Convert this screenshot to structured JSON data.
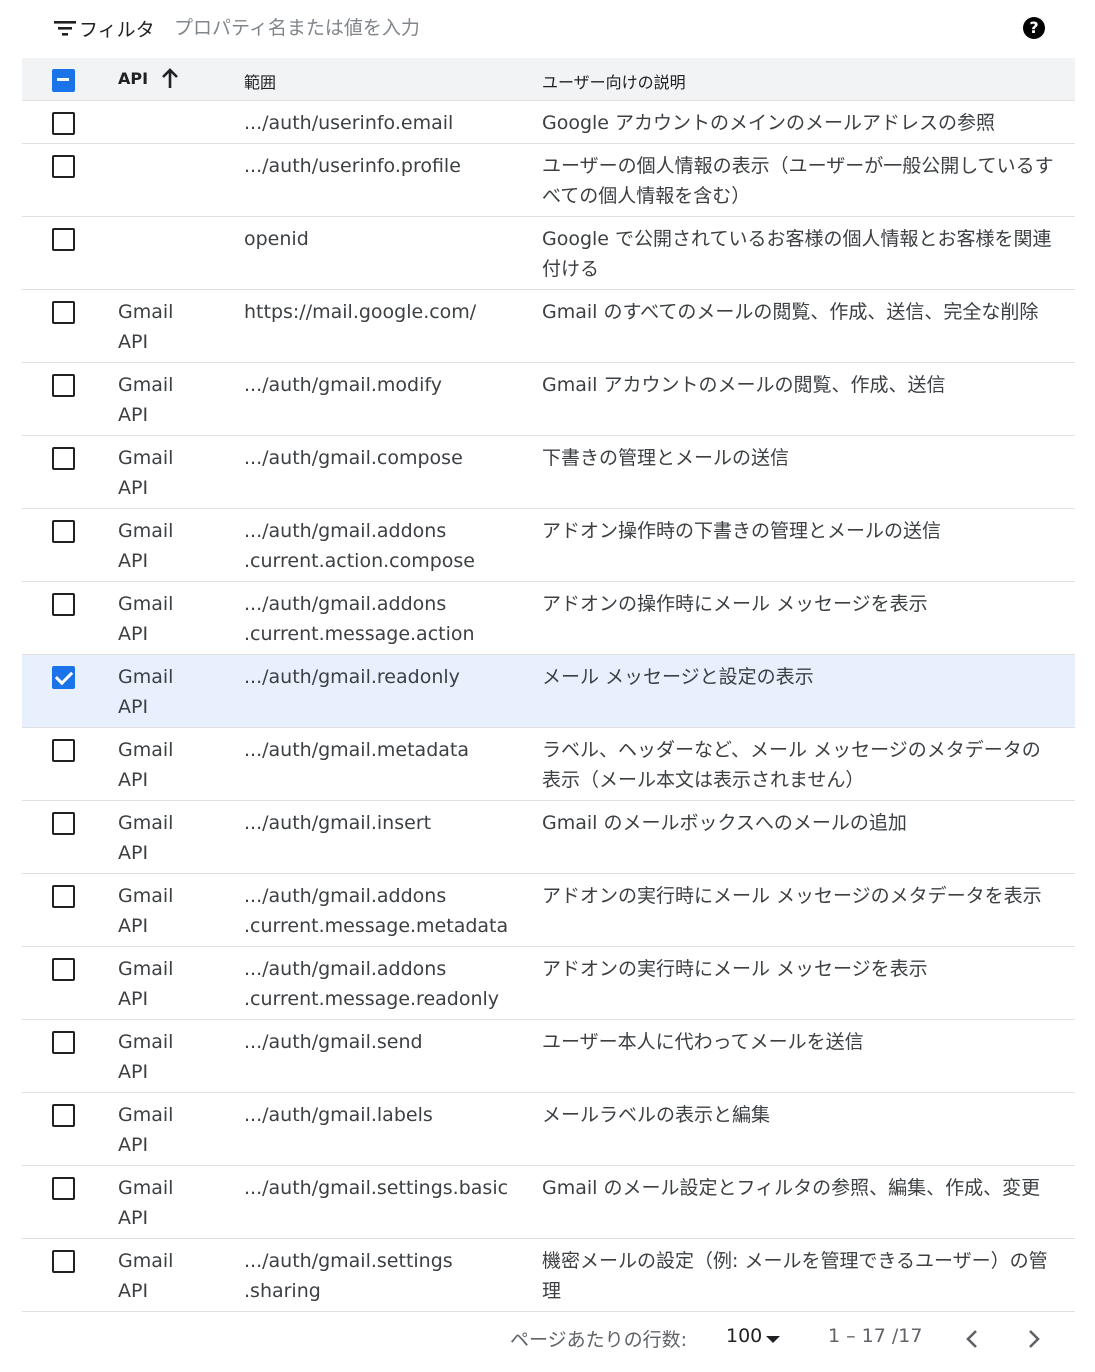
{
  "filter": {
    "label": "フィルタ",
    "placeholder": "プロパティ名または値を入力"
  },
  "header": {
    "api": "API",
    "scope": "範囲",
    "description": "ユーザー向けの説明"
  },
  "rows": [
    {
      "api": "",
      "scope": ".../auth/userinfo.email",
      "desc": "Google アカウントのメインのメールアドレスの参照",
      "checked": false
    },
    {
      "api": "",
      "scope": ".../auth/userinfo.profile",
      "desc": "ユーザーの個人情報の表示（ユーザーが一般公開しているすべての個人情報を含む）",
      "checked": false
    },
    {
      "api": "",
      "scope": "openid",
      "desc": "Google で公開されているお客様の個人情報とお客様を関連付ける",
      "checked": false
    },
    {
      "api": "Gmail API",
      "scope": "https://mail.google.com/",
      "desc": "Gmail のすべてのメールの閲覧、作成、送信、完全な削除",
      "checked": false
    },
    {
      "api": "Gmail API",
      "scope": ".../auth/gmail.modify",
      "desc": "Gmail アカウントのメールの閲覧、作成、送信",
      "checked": false
    },
    {
      "api": "Gmail API",
      "scope": ".../auth/gmail.compose",
      "desc": "下書きの管理とメールの送信",
      "checked": false
    },
    {
      "api": "Gmail API",
      "scope": ".../auth/gmail.addons .current.action.compose",
      "desc": "アドオン操作時の下書きの管理とメールの送信",
      "checked": false
    },
    {
      "api": "Gmail API",
      "scope": ".../auth/gmail.addons .current.message.action",
      "desc": "アドオンの操作時にメール メッセージを表示",
      "checked": false
    },
    {
      "api": "Gmail API",
      "scope": ".../auth/gmail.readonly",
      "desc": "メール メッセージと設定の表示",
      "checked": true
    },
    {
      "api": "Gmail API",
      "scope": ".../auth/gmail.metadata",
      "desc": "ラベル、ヘッダーなど、メール メッセージのメタデータの表示（メール本文は表示されません）",
      "checked": false
    },
    {
      "api": "Gmail API",
      "scope": ".../auth/gmail.insert",
      "desc": "Gmail のメールボックスへのメールの追加",
      "checked": false
    },
    {
      "api": "Gmail API",
      "scope": ".../auth/gmail.addons .current.message.metadata",
      "desc": "アドオンの実行時にメール メッセージのメタデータを表示",
      "checked": false
    },
    {
      "api": "Gmail API",
      "scope": ".../auth/gmail.addons .current.message.readonly",
      "desc": "アドオンの実行時にメール メッセージを表示",
      "checked": false
    },
    {
      "api": "Gmail API",
      "scope": ".../auth/gmail.send",
      "desc": "ユーザー本人に代わってメールを送信",
      "checked": false
    },
    {
      "api": "Gmail API",
      "scope": ".../auth/gmail.labels",
      "desc": "メールラベルの表示と編集",
      "checked": false
    },
    {
      "api": "Gmail API",
      "scope": ".../auth/gmail.settings.basic",
      "desc": "Gmail のメール設定とフィルタの参照、編集、作成、変更",
      "checked": false
    },
    {
      "api": "Gmail API",
      "scope": ".../auth/gmail.settings .sharing",
      "desc": "機密メールの設定（例: メールを管理できるユーザー）の管理",
      "checked": false
    }
  ],
  "footer": {
    "rows_per_page_label": "ページあたりの行数:",
    "rows_per_page_value": "100",
    "range": "1 – 17 /17"
  },
  "colors": {
    "accent": "#1a73e8",
    "selected_row": "#e8f0fe",
    "header_bg": "#f1f3f4"
  }
}
